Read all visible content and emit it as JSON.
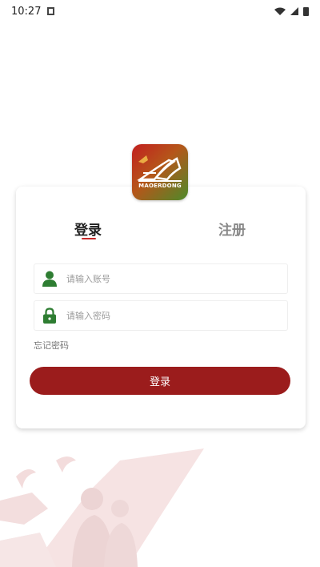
{
  "status_bar": {
    "time": "10:27"
  },
  "logo": {
    "text": "MAOERDONG"
  },
  "tabs": {
    "login": "登录",
    "register": "注册"
  },
  "form": {
    "account_placeholder": "请输入账号",
    "password_placeholder": "请输入密码",
    "forgot_password": "忘记密码",
    "login_button": "登录"
  },
  "colors": {
    "accent": "#9b1c1c",
    "icon_green": "#2e7d32"
  }
}
